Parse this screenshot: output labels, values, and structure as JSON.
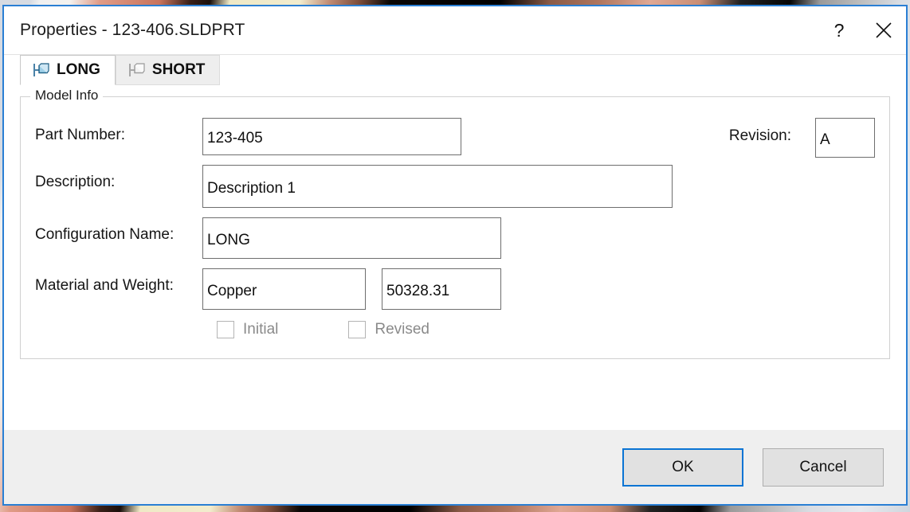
{
  "window": {
    "title": "Properties - 123-406.SLDPRT",
    "help_icon": "question-mark-icon",
    "close_icon": "close-x-icon",
    "accent_color": "#2a7fd4"
  },
  "tabs": [
    {
      "label": "LONG",
      "icon": "configuration-icon",
      "active": true
    },
    {
      "label": "SHORT",
      "icon": "configuration-icon",
      "active": false
    }
  ],
  "group": {
    "label": "Model Info"
  },
  "fields": {
    "part_number": {
      "label": "Part Number:",
      "value": "123-405",
      "placeholder": ""
    },
    "revision": {
      "label": "Revision:",
      "value": "A",
      "placeholder": ""
    },
    "description": {
      "label": "Description:",
      "value": "Description 1",
      "placeholder": ""
    },
    "configuration_name": {
      "label": "Configuration Name:",
      "value": "LONG",
      "placeholder": ""
    },
    "material_weight": {
      "label": "Material and Weight:",
      "material_value": "Copper",
      "weight_value": "50328.31",
      "material_placeholder": "",
      "weight_placeholder": ""
    }
  },
  "checkboxes": [
    {
      "label": "Initial",
      "checked": false,
      "disabled": true
    },
    {
      "label": "Revised",
      "checked": false,
      "disabled": true
    }
  ],
  "footer": {
    "ok_label": "OK",
    "cancel_label": "Cancel"
  }
}
